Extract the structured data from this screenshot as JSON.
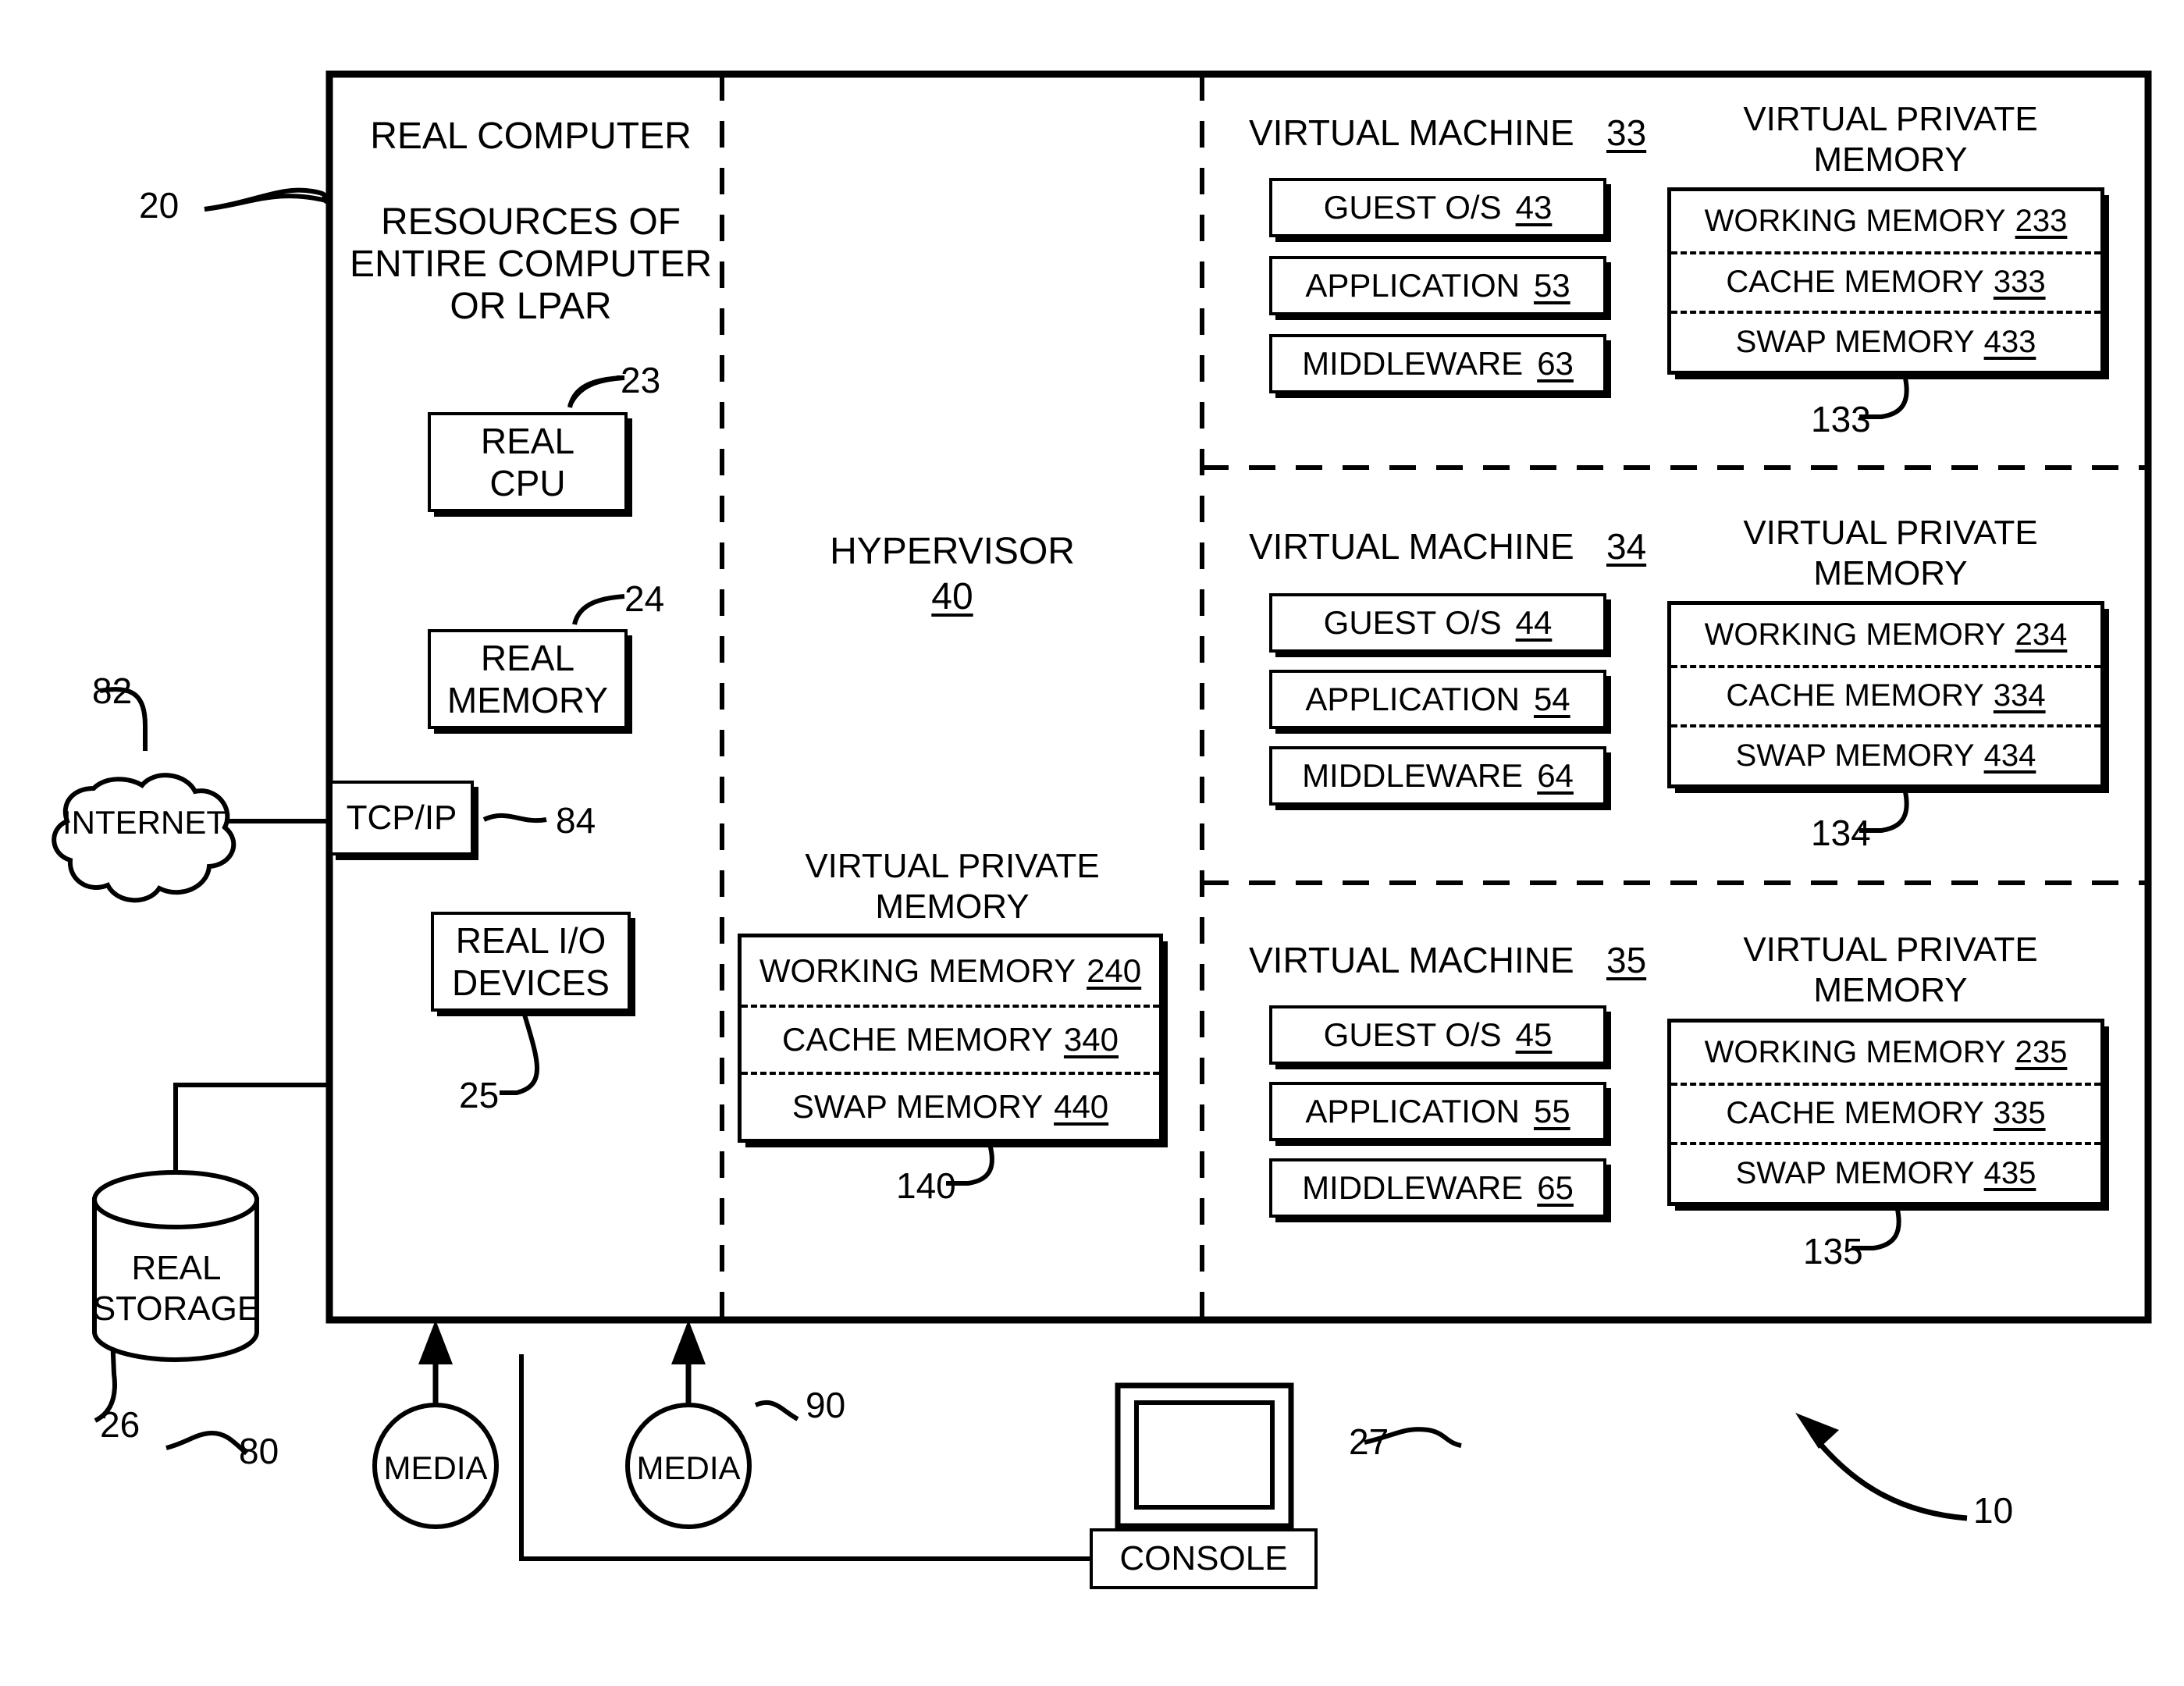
{
  "figure": {
    "overall_ref": "10",
    "real_computer_ref": "20"
  },
  "real_computer": {
    "title": "REAL COMPUTER",
    "subtitle_line1": "RESOURCES OF",
    "subtitle_line2": "ENTIRE COMPUTER",
    "subtitle_line3": "OR LPAR",
    "cpu": {
      "line1": "REAL",
      "line2": "CPU",
      "ref": "23"
    },
    "memory": {
      "line1": "REAL",
      "line2": "MEMORY",
      "ref": "24"
    },
    "io_devices": {
      "line1": "REAL I/O",
      "line2": "DEVICES",
      "ref": "25"
    },
    "tcpip": {
      "label": "TCP/IP",
      "ref": "84"
    }
  },
  "network": {
    "internet": {
      "label": "INTERNET",
      "ref": "82"
    }
  },
  "storage": {
    "real_storage": {
      "line1": "REAL",
      "line2": "STORAGE",
      "ref": "26"
    }
  },
  "media": [
    {
      "label": "MEDIA",
      "ref": "80"
    },
    {
      "label": "MEDIA",
      "ref": "90"
    }
  ],
  "console": {
    "label": "CONSOLE",
    "ref": "27"
  },
  "hypervisor": {
    "title": "HYPERVISOR",
    "ref": "40",
    "vpm": {
      "title_line1": "VIRTUAL PRIVATE",
      "title_line2": "MEMORY",
      "ref": "140",
      "rows": [
        {
          "label": "WORKING MEMORY",
          "ref": "240"
        },
        {
          "label": "CACHE MEMORY",
          "ref": "340"
        },
        {
          "label": "SWAP MEMORY",
          "ref": "440"
        }
      ]
    }
  },
  "virtual_machines": [
    {
      "title": "VIRTUAL MACHINE",
      "ref": "33",
      "components": [
        {
          "label": "GUEST O/S",
          "ref": "43"
        },
        {
          "label": "APPLICATION",
          "ref": "53"
        },
        {
          "label": "MIDDLEWARE",
          "ref": "63"
        }
      ],
      "vpm": {
        "title_line1": "VIRTUAL PRIVATE",
        "title_line2": "MEMORY",
        "ref": "133",
        "rows": [
          {
            "label": "WORKING MEMORY",
            "ref": "233"
          },
          {
            "label": "CACHE MEMORY",
            "ref": "333"
          },
          {
            "label": "SWAP MEMORY",
            "ref": "433"
          }
        ]
      }
    },
    {
      "title": "VIRTUAL MACHINE",
      "ref": "34",
      "components": [
        {
          "label": "GUEST O/S",
          "ref": "44"
        },
        {
          "label": "APPLICATION",
          "ref": "54"
        },
        {
          "label": "MIDDLEWARE",
          "ref": "64"
        }
      ],
      "vpm": {
        "title_line1": "VIRTUAL PRIVATE",
        "title_line2": "MEMORY",
        "ref": "134",
        "rows": [
          {
            "label": "WORKING MEMORY",
            "ref": "234"
          },
          {
            "label": "CACHE MEMORY",
            "ref": "334"
          },
          {
            "label": "SWAP MEMORY",
            "ref": "434"
          }
        ]
      }
    },
    {
      "title": "VIRTUAL MACHINE",
      "ref": "35",
      "components": [
        {
          "label": "GUEST O/S",
          "ref": "45"
        },
        {
          "label": "APPLICATION",
          "ref": "55"
        },
        {
          "label": "MIDDLEWARE",
          "ref": "65"
        }
      ],
      "vpm": {
        "title_line1": "VIRTUAL PRIVATE",
        "title_line2": "MEMORY",
        "ref": "135",
        "rows": [
          {
            "label": "WORKING MEMORY",
            "ref": "235"
          },
          {
            "label": "CACHE MEMORY",
            "ref": "335"
          },
          {
            "label": "SWAP MEMORY",
            "ref": "435"
          }
        ]
      }
    }
  ]
}
